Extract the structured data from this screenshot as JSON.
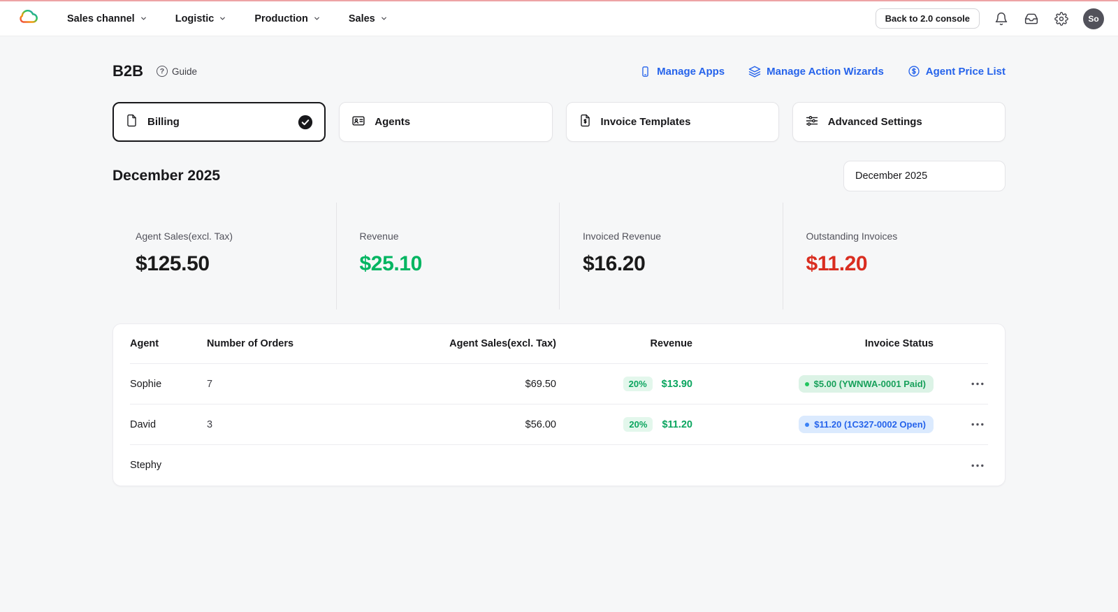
{
  "topnav": {
    "logo_icon": "rainbow-cloud-logo",
    "menus": [
      {
        "label": "Sales channel"
      },
      {
        "label": "Logistic"
      },
      {
        "label": "Production"
      },
      {
        "label": "Sales"
      }
    ],
    "back_button_label": "Back to 2.0 console",
    "right_icons": [
      "bell-icon",
      "inbox-icon",
      "gear-icon"
    ],
    "avatar_initials": "So"
  },
  "header": {
    "title": "B2B",
    "guide_label": "Guide",
    "links": [
      {
        "label": "Manage Apps",
        "icon": "phone-icon"
      },
      {
        "label": "Manage Action Wizards",
        "icon": "layers-icon"
      },
      {
        "label": "Agent Price List",
        "icon": "dollar-circle-icon"
      }
    ]
  },
  "tabs": [
    {
      "label": "Billing",
      "icon": "document-icon",
      "active": true
    },
    {
      "label": "Agents",
      "icon": "id-card-icon",
      "active": false
    },
    {
      "label": "Invoice Templates",
      "icon": "invoice-icon",
      "active": false
    },
    {
      "label": "Advanced Settings",
      "icon": "sliders-icon",
      "active": false
    }
  ],
  "period": {
    "heading": "December 2025",
    "selector_value": "December 2025"
  },
  "stats": [
    {
      "label": "Agent Sales(excl. Tax)",
      "value": "$125.50",
      "color": "#1a1a1a"
    },
    {
      "label": "Revenue",
      "value": "$25.10",
      "color": "#00b561"
    },
    {
      "label": "Invoiced Revenue",
      "value": "$16.20",
      "color": "#1a1a1a"
    },
    {
      "label": "Outstanding Invoices",
      "value": "$11.20",
      "color": "#d92d20"
    }
  ],
  "table": {
    "headers": {
      "agent": "Agent",
      "orders": "Number of Orders",
      "sales": "Agent Sales(excl. Tax)",
      "revenue": "Revenue",
      "status": "Invoice Status"
    },
    "rows": [
      {
        "agent": "Sophie",
        "orders": "7",
        "sales": "$69.50",
        "revenue_pct": "20%",
        "revenue": "$13.90",
        "status": "$5.00  (YWNWA-0001 Paid)",
        "status_type": "paid"
      },
      {
        "agent": "David",
        "orders": "3",
        "sales": "$56.00",
        "revenue_pct": "20%",
        "revenue": "$11.20",
        "status": "$11.20  (1C327-0002 Open)",
        "status_type": "open"
      },
      {
        "agent": "Stephy",
        "orders": "",
        "sales": "",
        "revenue_pct": "",
        "revenue": "",
        "status": "",
        "status_type": ""
      }
    ],
    "row_menu_icon": "ellipsis-icon"
  },
  "colors": {
    "link_blue": "#2563eb",
    "positive_green": "#00b561",
    "negative_red": "#d92d20",
    "pill_paid_bg": "#dcf3e6",
    "pill_open_bg": "#dbeafe",
    "page_bg": "#f6f7f8"
  }
}
